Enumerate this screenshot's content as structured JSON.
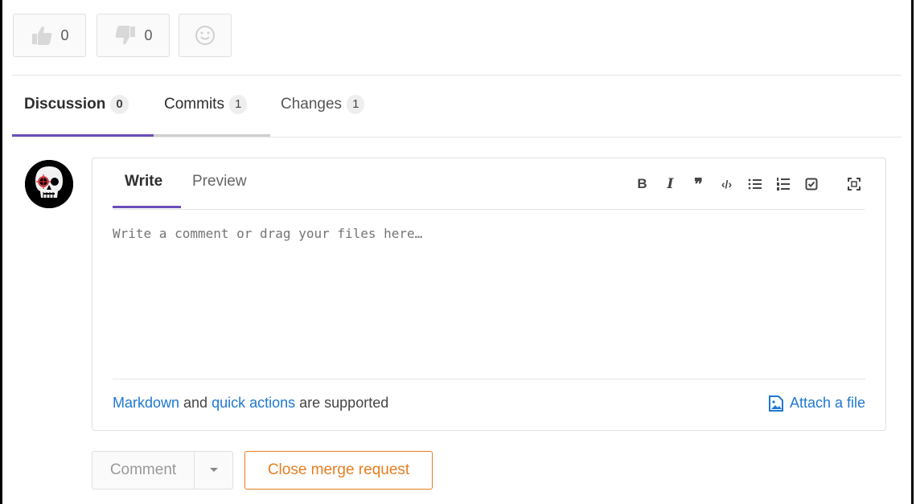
{
  "awards": {
    "thumbs_up_count": "0",
    "thumbs_down_count": "0"
  },
  "tabs": [
    {
      "label": "Discussion",
      "count": "0"
    },
    {
      "label": "Commits",
      "count": "1"
    },
    {
      "label": "Changes",
      "count": "1"
    }
  ],
  "editor": {
    "tab_write": "Write",
    "tab_preview": "Preview",
    "toolbar": {
      "bold": "B",
      "italic": "I",
      "quote": "❞",
      "code": "‹/›"
    },
    "placeholder": "Write a comment or drag your files here…",
    "footer": {
      "markdown_link": "Markdown",
      "and_text": " and ",
      "quick_actions_link": "quick actions",
      "supported_text": " are supported",
      "attach_label": "Attach a file"
    }
  },
  "actions": {
    "comment_label": "Comment",
    "close_label": "Close merge request"
  },
  "colors": {
    "accent_tab": "#6b4fbb",
    "link": "#1f78d1",
    "close_button": "#e67e22"
  }
}
